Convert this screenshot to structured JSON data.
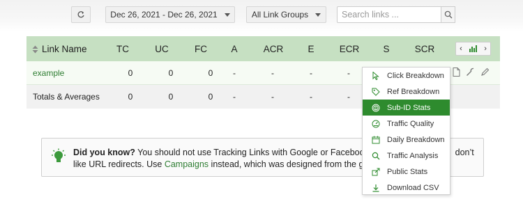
{
  "toolbar": {
    "date_range": "Dec 26, 2021 - Dec 26, 2021",
    "groups_label": "All Link Groups",
    "search_placeholder": "Search links ..."
  },
  "table": {
    "columns": [
      "Link Name",
      "TC",
      "UC",
      "FC",
      "A",
      "ACR",
      "E",
      "ECR",
      "S",
      "SCR"
    ],
    "rows": [
      {
        "name": "example",
        "values": [
          "0",
          "0",
          "0",
          "-",
          "-",
          "-",
          "-"
        ]
      },
      {
        "name": "Totals & Averages",
        "values": [
          "0",
          "0",
          "0",
          "-",
          "-",
          "-",
          "-"
        ]
      }
    ]
  },
  "menu": {
    "items": [
      {
        "label": "Click Breakdown",
        "icon": "cursor-icon"
      },
      {
        "label": "Ref Breakdown",
        "icon": "tag-icon"
      },
      {
        "label": "Sub-ID Stats",
        "icon": "fingerprint-icon"
      },
      {
        "label": "Traffic Quality",
        "icon": "gauge-icon"
      },
      {
        "label": "Daily Breakdown",
        "icon": "calendar-icon"
      },
      {
        "label": "Traffic Analysis",
        "icon": "search-icon"
      },
      {
        "label": "Public Stats",
        "icon": "share-icon"
      },
      {
        "label": "Download CSV",
        "icon": "download-icon"
      }
    ],
    "active_index": 2
  },
  "tip": {
    "heading": "Did you know?",
    "line1_part1": " You should not use Tracking Links with Google or Facebook Ads,",
    "line1_part2": "don’t",
    "line2_part1": "like URL redirects. Use ",
    "line2_link": "Campaigns",
    "line2_part2": " instead, which was designed from the ground"
  },
  "colors": {
    "header_bg": "#c6e0c2",
    "accent_green": "#2e8b2e",
    "link_green": "#2e7d32"
  }
}
